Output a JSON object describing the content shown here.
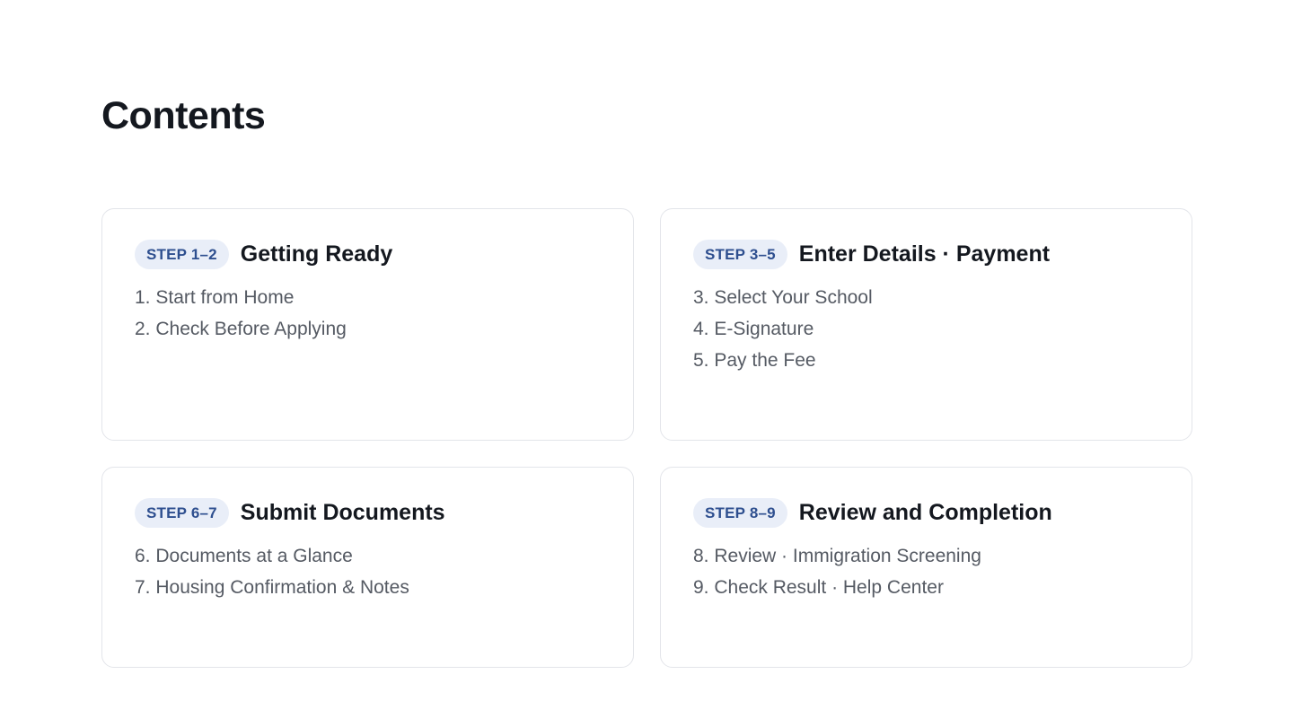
{
  "page": {
    "title": "Contents"
  },
  "sections": [
    {
      "step": "STEP 1–2",
      "title": "Getting Ready",
      "items": [
        "1. Start from Home",
        "2. Check Before Applying"
      ]
    },
    {
      "step": "STEP 3–5",
      "title": "Enter Details · Payment",
      "items": [
        "3. Select Your School",
        "4. E-Signature",
        "5. Pay the Fee"
      ]
    },
    {
      "step": "STEP 6–7",
      "title": "Submit Documents",
      "items": [
        "6. Documents at a Glance",
        "7. Housing Confirmation & Notes"
      ]
    },
    {
      "step": "STEP 8–9",
      "title": "Review and Completion",
      "items": [
        "8. Review · Immigration Screening",
        "9. Check Result · Help Center"
      ]
    }
  ],
  "colors": {
    "badge_bg": "#e9eef8",
    "badge_text": "#2e4f8f",
    "heading": "#14181f",
    "item_text": "#555a63",
    "card_border": "#e3e5ea"
  }
}
